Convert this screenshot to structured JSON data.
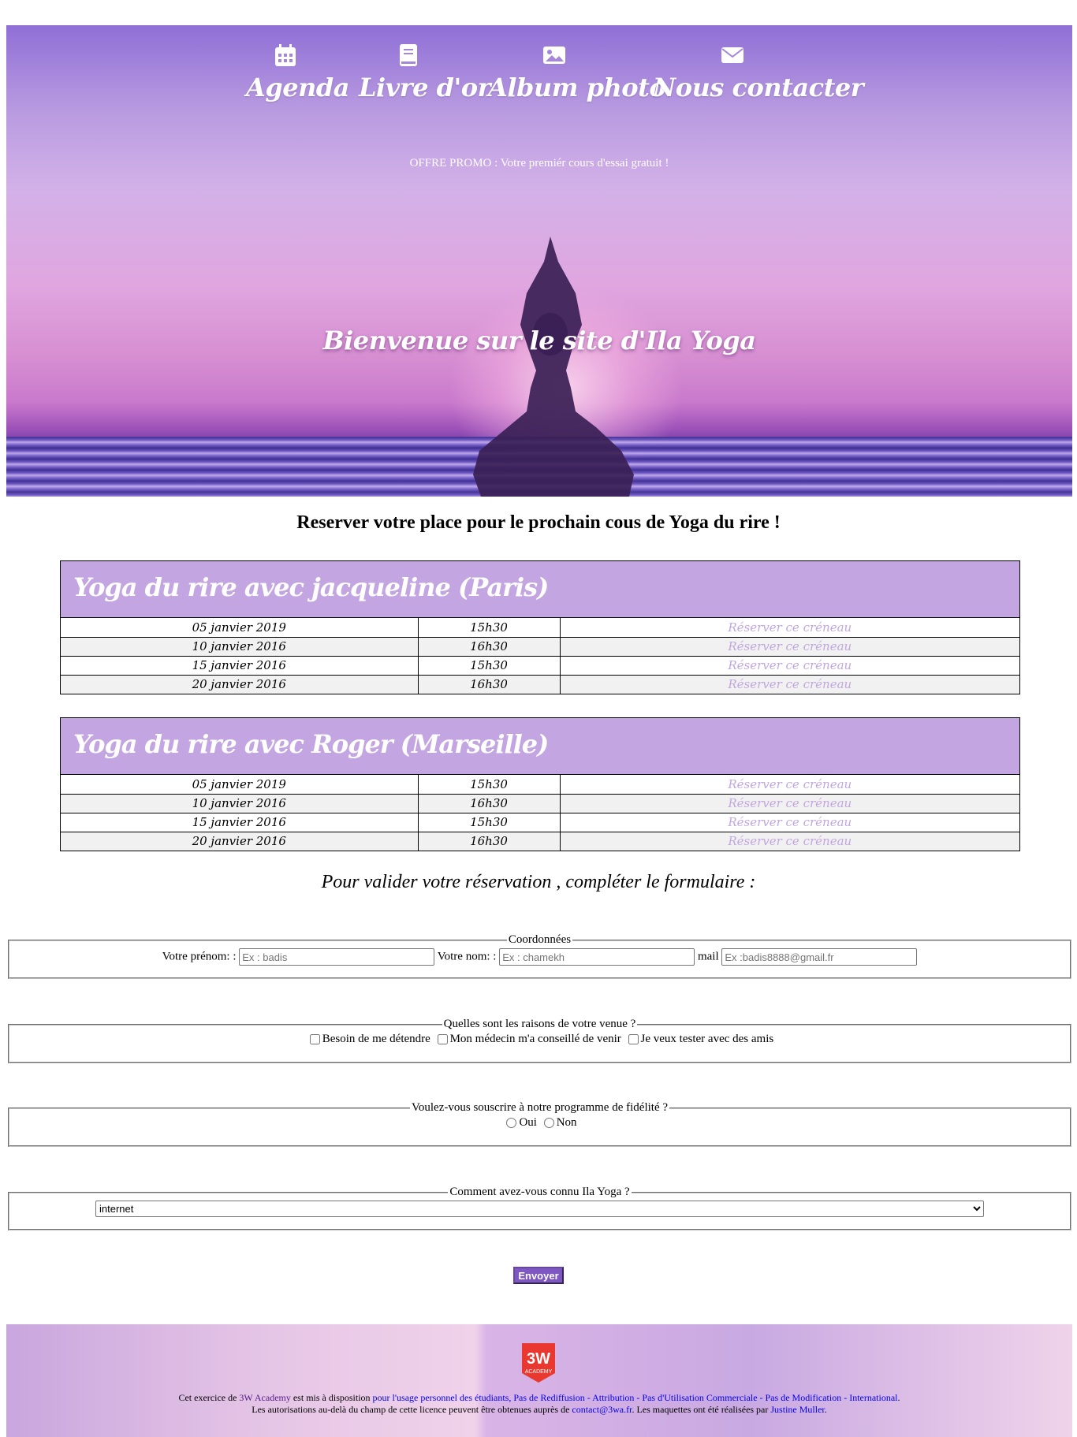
{
  "nav": {
    "items": [
      {
        "label": "Agenda",
        "icon": "calendar-icon"
      },
      {
        "label": "Livre d'or",
        "icon": "book-icon"
      },
      {
        "label": "Album photo",
        "icon": "image-icon"
      },
      {
        "label": "Nous contacter",
        "icon": "envelope-icon"
      }
    ]
  },
  "hero": {
    "promo": "OFFRE PROMO : Votre premiér cours d'essai gratuit !",
    "welcome": "Bienvenue sur le site d'Ila Yoga"
  },
  "reserve_title": "Reserver votre place pour le prochain cous de Yoga du rire !",
  "courses": [
    {
      "title": "Yoga du rire avec jacqueline (Paris)",
      "rows": [
        {
          "date": "05 janvier 2019",
          "time": "15h30",
          "link": "Réserver ce créneau"
        },
        {
          "date": "10 janvier 2016",
          "time": "16h30",
          "link": "Réserver ce créneau"
        },
        {
          "date": "15 janvier 2016",
          "time": "15h30",
          "link": "Réserver ce créneau"
        },
        {
          "date": "20 janvier 2016",
          "time": "16h30",
          "link": "Réserver ce créneau"
        }
      ]
    },
    {
      "title": "Yoga du rire avec Roger (Marseille)",
      "rows": [
        {
          "date": "05 janvier 2019",
          "time": "15h30",
          "link": "Réserver ce créneau"
        },
        {
          "date": "10 janvier 2016",
          "time": "16h30",
          "link": "Réserver ce créneau"
        },
        {
          "date": "15 janvier 2016",
          "time": "15h30",
          "link": "Réserver ce créneau"
        },
        {
          "date": "20 janvier 2016",
          "time": "16h30",
          "link": "Réserver ce créneau"
        }
      ]
    }
  ],
  "form": {
    "intro": "Pour valider votre réservation , compléter le formulaire :",
    "coords": {
      "legend": "Coordonnées",
      "prenom_label": "Votre prénom: :",
      "prenom_placeholder": "Ex : badis",
      "nom_label": "Votre nom: :",
      "nom_placeholder": "Ex : chamekh",
      "mail_label": "mail",
      "mail_placeholder": "Ex :badis8888@gmail.fr"
    },
    "reasons": {
      "legend": "Quelles sont les raisons de votre venue ?",
      "options": [
        "Besoin de me détendre",
        "Mon médecin m'a conseillé de venir",
        "Je veux tester avec des amis"
      ]
    },
    "fidelity": {
      "legend": "Voulez-vous souscrire à notre programme de fidélité ?",
      "options": [
        "Oui",
        "Non"
      ]
    },
    "source": {
      "legend": "Comment avez-vous connu Ila Yoga ?",
      "selected": "internet"
    },
    "submit_label": "Envoyer"
  },
  "footer": {
    "logo_text": "3W",
    "logo_sub": "ACADEMY",
    "l1_prefix": "Cet exercice de ",
    "l1_link1": "3W Academy",
    "l1_mid": " est mis à disposition ",
    "l1_link2": "pour l'usage personnel des étudiants, Pas de Rediffusion - Attribution - Pas d'Utilisation Commerciale - Pas de Modification - International",
    "l1_end": ".",
    "l2_prefix": "Les autorisations au-delà du champ de cette licence peuvent être obtenues auprès de ",
    "l2_link1": "contact@3wa.fr",
    "l2_mid": ". Les maquettes ont été réalisées par ",
    "l2_link2": "Justine Muller",
    "l2_end": "."
  },
  "colors": {
    "accent": "#c3a6e1",
    "button": "#7e57c2"
  }
}
